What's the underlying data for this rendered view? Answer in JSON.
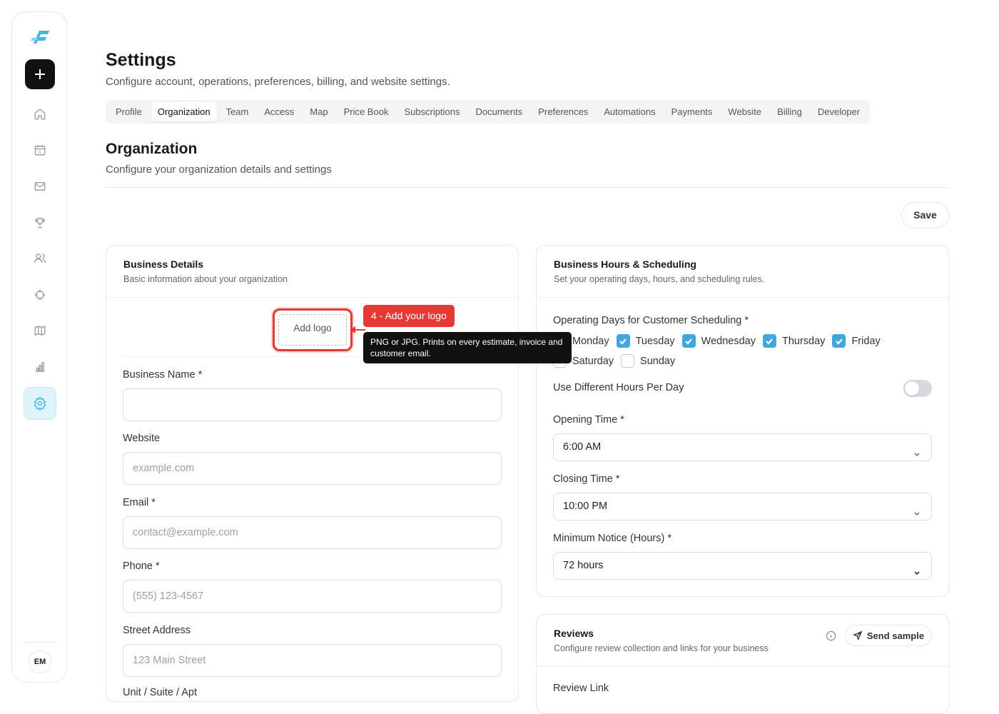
{
  "sidebar": {
    "avatar_initials": "EM",
    "items": [
      {
        "icon": "home-icon"
      },
      {
        "icon": "calendar-icon",
        "badge": "31"
      },
      {
        "icon": "mail-icon"
      },
      {
        "icon": "trophy-icon"
      },
      {
        "icon": "users-icon"
      },
      {
        "icon": "crosshair-icon"
      },
      {
        "icon": "map-icon"
      },
      {
        "icon": "bar-chart-icon"
      },
      {
        "icon": "gear-icon",
        "active": true
      }
    ],
    "add_icon": "plus-icon"
  },
  "page": {
    "title": "Settings",
    "subtitle": "Configure account, operations, preferences, billing, and website settings."
  },
  "tabs": [
    "Profile",
    "Organization",
    "Team",
    "Access",
    "Map",
    "Price Book",
    "Subscriptions",
    "Documents",
    "Preferences",
    "Automations",
    "Payments",
    "Website",
    "Billing",
    "Developer"
  ],
  "active_tab": "Organization",
  "section": {
    "title": "Organization",
    "subtitle": "Configure your organization details and settings",
    "save_label": "Save"
  },
  "business_details": {
    "title": "Business Details",
    "subtitle": "Basic information about your organization",
    "add_logo_label": "Add logo",
    "callout_label": "4 - Add your logo",
    "tooltip": "PNG or JPG. Prints on every estimate, invoice and customer email.",
    "fields": {
      "business_name": {
        "label": "Business Name *",
        "value": ""
      },
      "website": {
        "label": "Website",
        "placeholder": "example.com"
      },
      "email": {
        "label": "Email *",
        "placeholder": "contact@example.com"
      },
      "phone": {
        "label": "Phone *",
        "placeholder": "(555) 123-4567"
      },
      "street": {
        "label": "Street Address",
        "placeholder": "123 Main Street"
      },
      "unit": {
        "label": "Unit / Suite / Apt"
      }
    }
  },
  "hours": {
    "title": "Business Hours & Scheduling",
    "subtitle": "Set your operating days, hours, and scheduling rules.",
    "days_label": "Operating Days for Customer Scheduling *",
    "days": [
      {
        "name": "Monday",
        "checked": true
      },
      {
        "name": "Tuesday",
        "checked": true
      },
      {
        "name": "Wednesday",
        "checked": true
      },
      {
        "name": "Thursday",
        "checked": true
      },
      {
        "name": "Friday",
        "checked": true
      },
      {
        "name": "Saturday",
        "checked": false
      },
      {
        "name": "Sunday",
        "checked": false
      }
    ],
    "different_hours_label": "Use Different Hours Per Day",
    "different_hours_on": false,
    "opening_label": "Opening Time *",
    "opening_value": "6:00 AM",
    "closing_label": "Closing Time *",
    "closing_value": "10:00 PM",
    "notice_label": "Minimum Notice (Hours) *",
    "notice_value": "72 hours"
  },
  "reviews": {
    "title": "Reviews",
    "subtitle": "Configure review collection and links for your business",
    "send_sample_label": "Send sample",
    "review_link_label": "Review Link"
  },
  "colors": {
    "accent": "#38b6e6",
    "checkbox": "#3fa7dc",
    "callout": "#e53935"
  }
}
